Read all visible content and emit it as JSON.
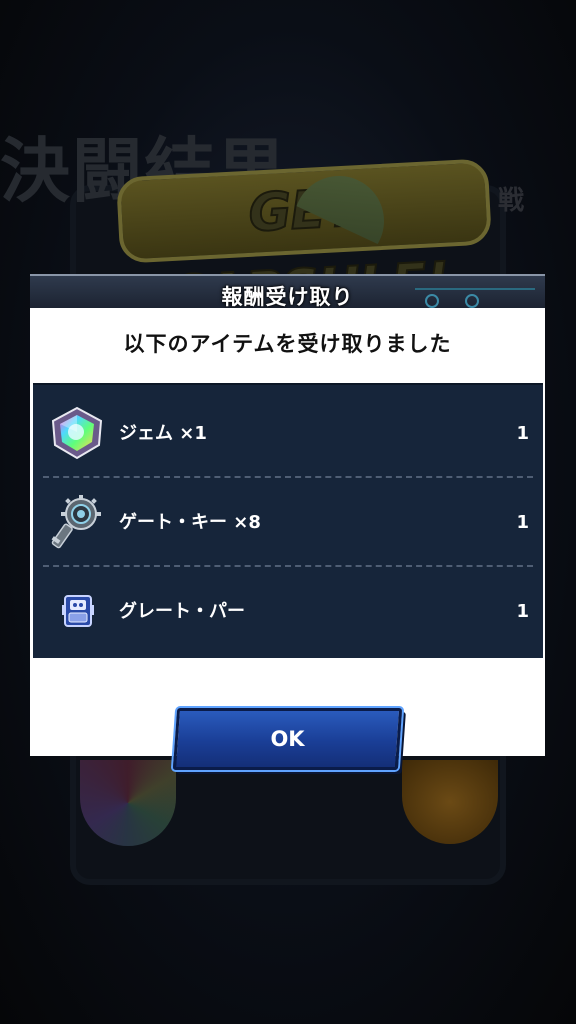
{
  "background": {
    "title_text": "決闘結果",
    "banner_text": "GET CAPSULE!",
    "side_text": "戦"
  },
  "modal": {
    "title": "報酬受け取り",
    "message": "以下のアイテムを受け取りました",
    "items": [
      {
        "name": "ジェム ×1",
        "count": "1",
        "icon": "gem-icon"
      },
      {
        "name": "ゲート・キー ×8",
        "count": "1",
        "icon": "gate-key-icon"
      },
      {
        "name": "グレート・パー",
        "count": "1",
        "icon": "great-pa-card-icon"
      }
    ],
    "ok_label": "OK"
  },
  "colors": {
    "panel_bg": "#16253a",
    "button_blue": "#1a3e96",
    "button_glow": "#5fa3ff"
  }
}
